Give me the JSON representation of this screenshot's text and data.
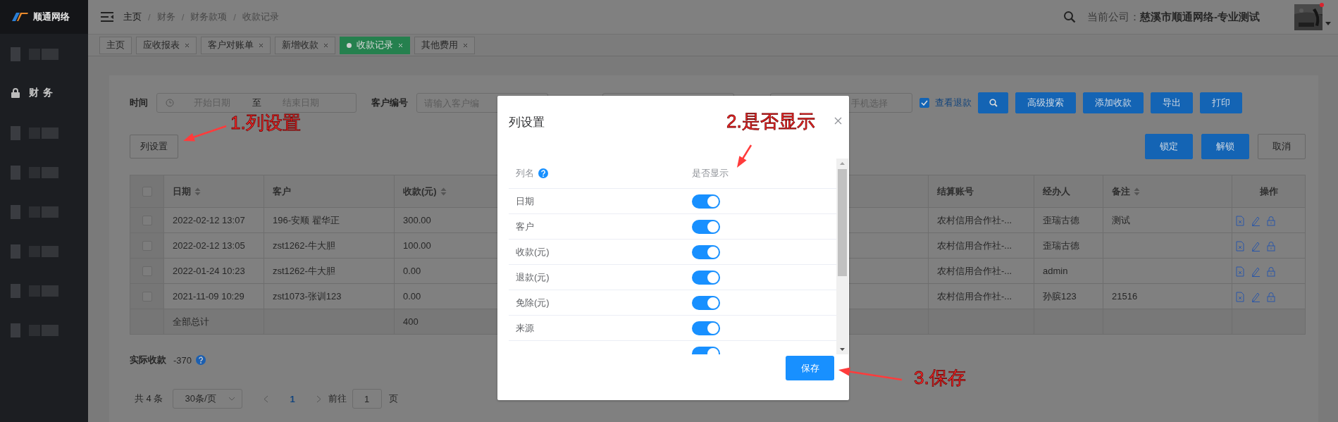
{
  "sidebar": {
    "brand": "顺通网络",
    "items": [
      {
        "kind": "blurred"
      },
      {
        "kind": "menu",
        "label": "财务"
      },
      {
        "kind": "blurred"
      },
      {
        "kind": "blurred"
      },
      {
        "kind": "blurred"
      },
      {
        "kind": "blurred"
      },
      {
        "kind": "blurred"
      },
      {
        "kind": "blurred"
      }
    ]
  },
  "header": {
    "breadcrumb": [
      "主页",
      "财务",
      "财务款项",
      "收款记录"
    ],
    "breadcrumb_separator": "/",
    "company_label": "当前公司：",
    "company_name": "慈溪市顺通网络-专业测试",
    "notification_dot": true
  },
  "tabs": [
    {
      "label": "主页",
      "closable": false,
      "selected": false
    },
    {
      "label": "应收报表",
      "closable": true,
      "selected": false
    },
    {
      "label": "客户对账单",
      "closable": true,
      "selected": false
    },
    {
      "label": "新增收款",
      "closable": true,
      "selected": false
    },
    {
      "label": "收款记录",
      "closable": true,
      "selected": true
    },
    {
      "label": "其他费用",
      "closable": true,
      "selected": false
    }
  ],
  "filters": {
    "time_label": "时间",
    "start_placeholder": "开始日期",
    "range_separator": "至",
    "end_placeholder": "结束日期",
    "customer_label": "客户编号",
    "customer_placeholder": "请输入客户编",
    "phone_placeholder": "手机选择",
    "show_refunds": {
      "label": "查看退款",
      "checked": true
    }
  },
  "toolbar": [
    "高级搜索",
    "添加收款",
    "导出",
    "打印"
  ],
  "column_settings_button": "列设置",
  "lock_buttons": [
    {
      "label": "锁定",
      "kind": "primary"
    },
    {
      "label": "解锁",
      "kind": "primary"
    },
    {
      "label": "取消",
      "kind": "plain"
    }
  ],
  "table": {
    "select_all_checked": false,
    "columns": [
      {
        "label": "日期",
        "sortable": true
      },
      {
        "label": "客户",
        "sortable": false
      },
      {
        "label": "收款(元)",
        "sortable": true
      },
      {
        "label": "结算账号",
        "sortable": false
      },
      {
        "label": "经办人",
        "sortable": false
      },
      {
        "label": "备注",
        "sortable": true
      },
      {
        "label": "操作",
        "sortable": false
      }
    ],
    "rows": [
      {
        "checked": false,
        "cells": [
          "2022-02-12 13:07",
          "196-安顺 翟华正",
          "300.00",
          "农村信用合作社-...",
          "歪瑞古德",
          "测试"
        ]
      },
      {
        "checked": false,
        "cells": [
          "2022-02-12 13:05",
          "zst1262-牛大胆",
          "100.00",
          "农村信用合作社-...",
          "歪瑞古德",
          ""
        ]
      },
      {
        "checked": false,
        "cells": [
          "2022-01-24 10:23",
          "zst1262-牛大胆",
          "0.00",
          "农村信用合作社-...",
          "admin",
          ""
        ]
      },
      {
        "checked": false,
        "cells": [
          "2021-11-09 10:29",
          "zst1073-张训123",
          "0.00",
          "农村信用合作社-...",
          "孙膑123",
          "21516"
        ]
      }
    ],
    "total_row": {
      "label": "全部总计",
      "amount": "400"
    }
  },
  "summary": {
    "label": "实际收款",
    "value": "-370"
  },
  "pagination": {
    "total": "共 4 条",
    "page_size": "30条/页",
    "pages": [
      {
        "label": "1",
        "selected": true
      }
    ],
    "goto_label": "前往",
    "goto_value": "1",
    "page_suffix": "页"
  },
  "dialog": {
    "title": "列设置",
    "header_name": "列名",
    "header_visible": "是否显示",
    "columns": [
      {
        "name": "日期",
        "shown": true
      },
      {
        "name": "客户",
        "shown": true
      },
      {
        "name": "收款(元)",
        "shown": true
      },
      {
        "name": "退款(元)",
        "shown": true
      },
      {
        "name": "免除(元)",
        "shown": true
      },
      {
        "name": "来源",
        "shown": true
      },
      {
        "shown": true
      }
    ],
    "save": "保存"
  },
  "annotations": [
    {
      "text": "1.列设置"
    },
    {
      "text": "2.是否显示"
    },
    {
      "text": "3.保存"
    }
  ]
}
